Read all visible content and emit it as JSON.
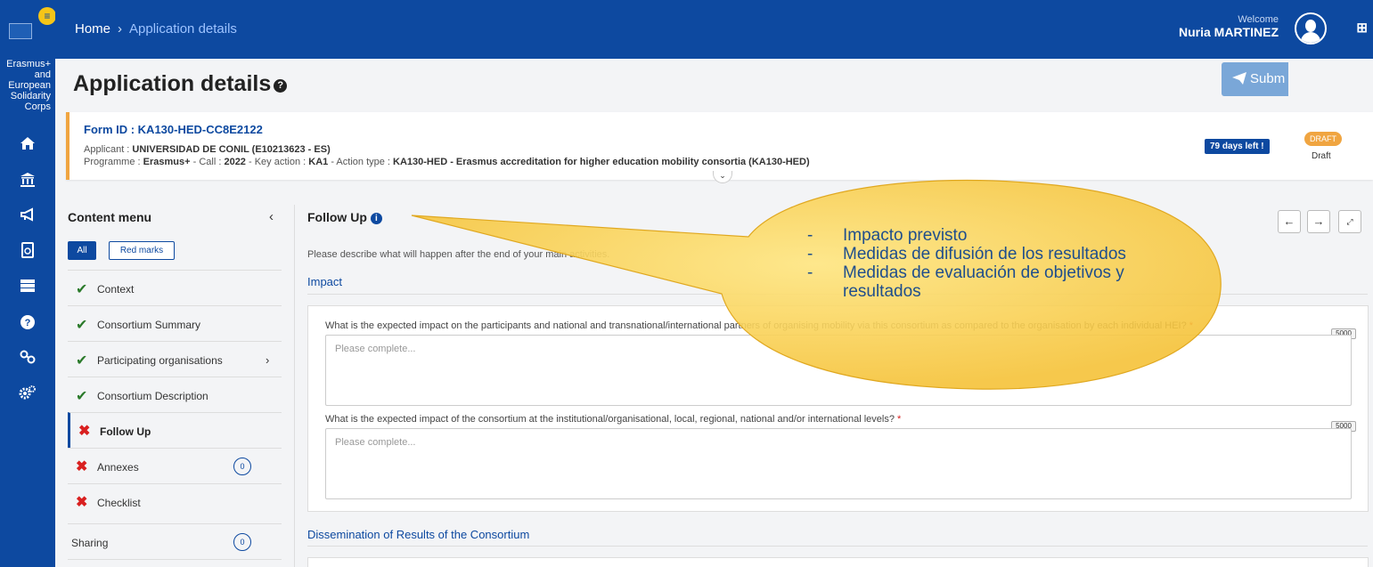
{
  "rail": {
    "title": "Erasmus+ and European Solidarity Corps",
    "icons": [
      "home-icon",
      "institution-icon",
      "megaphone-icon",
      "document-icon",
      "server-icon",
      "help-icon",
      "link-icon",
      "settings-icon"
    ]
  },
  "topbar": {
    "home": "Home",
    "current": "Application details",
    "welcome": "Welcome",
    "user": "Nuria MARTINEZ"
  },
  "page": {
    "title": "Application details",
    "submit": "Subm"
  },
  "form": {
    "id_label": "Form ID : KA130-HED-CC8E2122",
    "applicant_label": "Applicant : ",
    "applicant_value": "UNIVERSIDAD DE CONIL (E10213623 - ES)",
    "programme_label": "Programme : ",
    "programme_value": "Erasmus+",
    "call_label": " - Call : ",
    "call_value": "2022",
    "key_action_label": " - Key action : ",
    "key_action_value": "KA1",
    "action_type_label": " - Action type : ",
    "action_type_value": "KA130-HED - Erasmus accreditation for higher education mobility consortia (KA130-HED)",
    "days_left": "79 days left !",
    "status_pill": "DRAFT",
    "status_text": "Draft"
  },
  "content_menu": {
    "title": "Content menu",
    "filter_all": "All",
    "filter_red": "Red marks",
    "items": [
      {
        "label": "Context",
        "status": "ok"
      },
      {
        "label": "Consortium Summary",
        "status": "ok"
      },
      {
        "label": "Participating organisations",
        "status": "ok"
      },
      {
        "label": "Consortium Description",
        "status": "ok"
      },
      {
        "label": "Follow Up",
        "status": "error"
      },
      {
        "label": "Annexes",
        "status": "error",
        "count": "0"
      },
      {
        "label": "Checklist",
        "status": "error"
      },
      {
        "label": "Sharing",
        "status": "none",
        "count": "0"
      }
    ]
  },
  "main": {
    "section_title": "Follow Up",
    "intro": "Please describe what will happen after the end of your main activities.",
    "impact_heading": "Impact",
    "q1": "What is the expected impact on the participants and national and transnational/international partners of organising mobility via this consortium as compared to the organisation by each individual HEI?",
    "q2": "What is the expected impact of the consortium at the institutional/organisational, local, regional, national and/or international levels?",
    "required_mark": "*",
    "max_chars": "5000",
    "placeholder": "Please complete...",
    "dissemination_heading": "Dissemination of Results of the Consortium"
  },
  "callout": {
    "bullet": "-",
    "lines": [
      "Impacto previsto",
      "Medidas de difusión de los resultados",
      "Medidas de evaluación de objetivos y resultados"
    ],
    "fill": "#ffd24d"
  }
}
